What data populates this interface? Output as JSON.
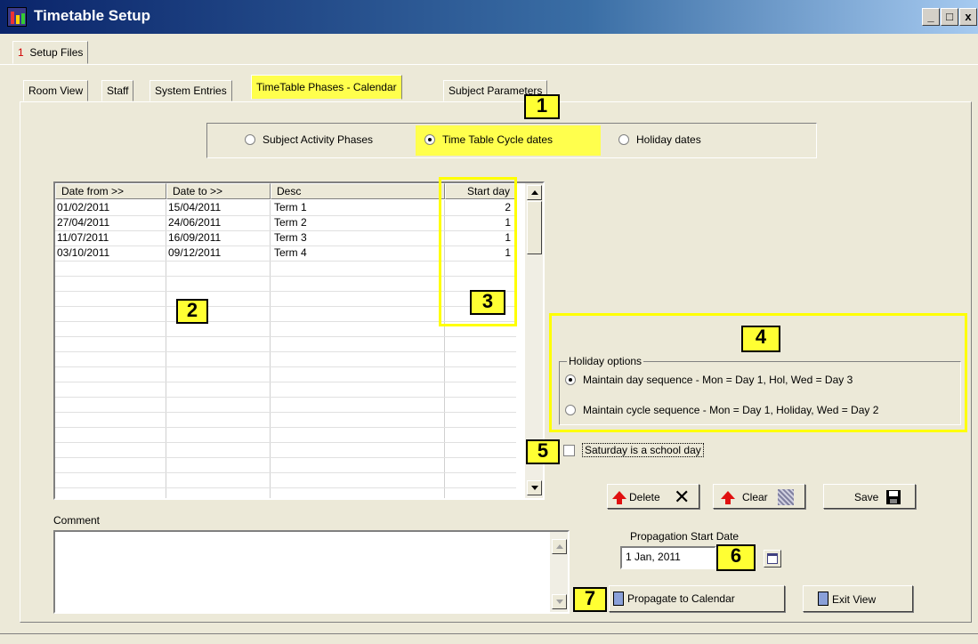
{
  "window": {
    "title": "Timetable Setup",
    "minimize": "_",
    "maximize": "□",
    "close": "x"
  },
  "outer_tab": {
    "number": "1",
    "label": "Setup Files"
  },
  "tabs": [
    "Room View",
    "Staff",
    "System Entries",
    "TimeTable Phases - Calendar",
    "Subject Parameters"
  ],
  "radios": {
    "subject_activity": "Subject Activity Phases",
    "cycle_dates": "Time Table Cycle dates",
    "holiday_dates": "Holiday dates",
    "selected": "Time Table Cycle dates"
  },
  "table": {
    "headers": [
      "Date from >>",
      "Date to >>",
      "Desc",
      "Start day"
    ],
    "rows": [
      {
        "from": "01/02/2011",
        "to": "15/04/2011",
        "desc": "Term 1",
        "start": "2"
      },
      {
        "from": "27/04/2011",
        "to": "24/06/2011",
        "desc": "Term 2",
        "start": "1"
      },
      {
        "from": "11/07/2011",
        "to": "16/09/2011",
        "desc": "Term 3",
        "start": "1"
      },
      {
        "from": "03/10/2011",
        "to": "09/12/2011",
        "desc": "Term 4",
        "start": "1"
      }
    ]
  },
  "holiday": {
    "group_label": "Holiday options",
    "opt1": "Maintain day sequence - Mon = Day 1, Hol, Wed = Day 3",
    "opt2": "Maintain cycle sequence - Mon = Day 1, Holiday, Wed = Day 2",
    "selected": "opt1"
  },
  "saturday_label": "Saturday is a school day",
  "buttons": {
    "delete": "Delete",
    "clear": "Clear",
    "save": "Save",
    "propagate": "Propagate to Calendar",
    "exit": "Exit View"
  },
  "comment_label": "Comment",
  "propagation": {
    "label": "Propagation Start Date",
    "value": "1 Jan, 2011"
  },
  "callouts": [
    "1",
    "2",
    "3",
    "4",
    "5",
    "6",
    "7"
  ],
  "colors": {
    "highlight": "#ffff4d",
    "callout_border": "#ffff00",
    "title_bar": "#0a246a"
  }
}
